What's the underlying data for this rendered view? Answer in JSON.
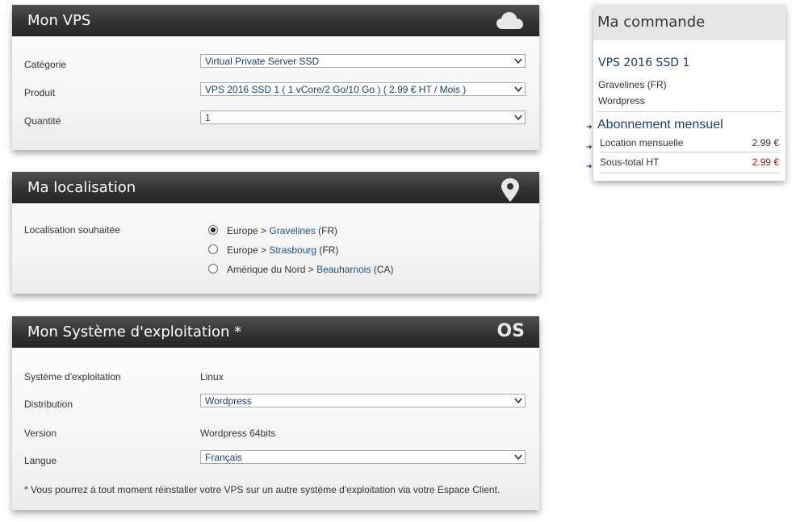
{
  "vps_panel": {
    "title": "Mon VPS",
    "icon": "cloud-icon",
    "fields": [
      {
        "label": "Catégorie",
        "value": "Virtual Private Server SSD"
      },
      {
        "label": "Produit",
        "value": "VPS 2016 SSD 1 ( 1 vCore/2 Go/10 Go ) ( 2.99 € HT / Mois )"
      },
      {
        "label": "Quantité",
        "value": "1"
      }
    ]
  },
  "location_panel": {
    "title": "Ma localisation",
    "icon": "map-pin-icon",
    "label": "Localisation souhaitée",
    "options": [
      {
        "prefix": "Europe > ",
        "city": "Gravelines",
        "suffix": " (FR)",
        "checked": true
      },
      {
        "prefix": "Europe > ",
        "city": "Strasbourg",
        "suffix": " (FR)",
        "checked": false
      },
      {
        "prefix": "Amérique du Nord > ",
        "city": "Beauharnois",
        "suffix": " (CA)",
        "checked": false
      }
    ]
  },
  "os_panel": {
    "title": "Mon Système d'exploitation *",
    "icon_text": "OS",
    "os_label": "Système d'exploitation",
    "os_value": "Linux",
    "distribution_label": "Distribution",
    "distribution_value": "Wordpress",
    "version_label": "Version",
    "version_value": "Wordpress 64bits",
    "language_label": "Langue",
    "language_value": "Français",
    "footnote": "* Vous pourrez à tout moment réinstaller votre VPS sur un autre système d'exploitation via votre Espace Client."
  },
  "cart": {
    "title": "Ma commande",
    "product": "VPS 2016 SSD 1",
    "location": "Gravelines (FR)",
    "distribution": "Wordpress",
    "section": "Abonnement mensuel",
    "items": [
      {
        "label": "Location mensuelle",
        "price": "2.99 €"
      },
      {
        "label": "Sous-total HT",
        "price": "2.99 €"
      }
    ],
    "accent_red": "#a01010"
  }
}
